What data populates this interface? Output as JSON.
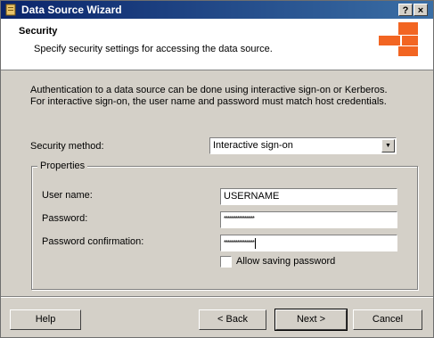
{
  "window": {
    "title": "Data Source Wizard",
    "help_btn": "?",
    "close_btn": "×"
  },
  "header": {
    "title": "Security",
    "subtitle": "Specify security settings for accessing the data source."
  },
  "description": "Authentication to a data source can be done using interactive sign-on or Kerberos. For interactive sign-on, the user name and password must match host credentials.",
  "security_method": {
    "label": "Security method:",
    "value": "Interactive sign-on"
  },
  "properties": {
    "legend": "Properties",
    "username": {
      "label": "User name:",
      "value": "USERNAME"
    },
    "password": {
      "label": "Password:",
      "masked": "****************"
    },
    "password_confirm": {
      "label": "Password confirmation:",
      "masked": "****************"
    },
    "allow_saving": {
      "label": "Allow saving password",
      "checked": false
    }
  },
  "buttons": {
    "help": "Help",
    "back": "< Back",
    "next": "Next >",
    "cancel": "Cancel"
  },
  "colors": {
    "titlebar_start": "#0a246a",
    "titlebar_end": "#3a6ea5",
    "logo": "#f26522",
    "dialog_bg": "#d4d0c8"
  }
}
